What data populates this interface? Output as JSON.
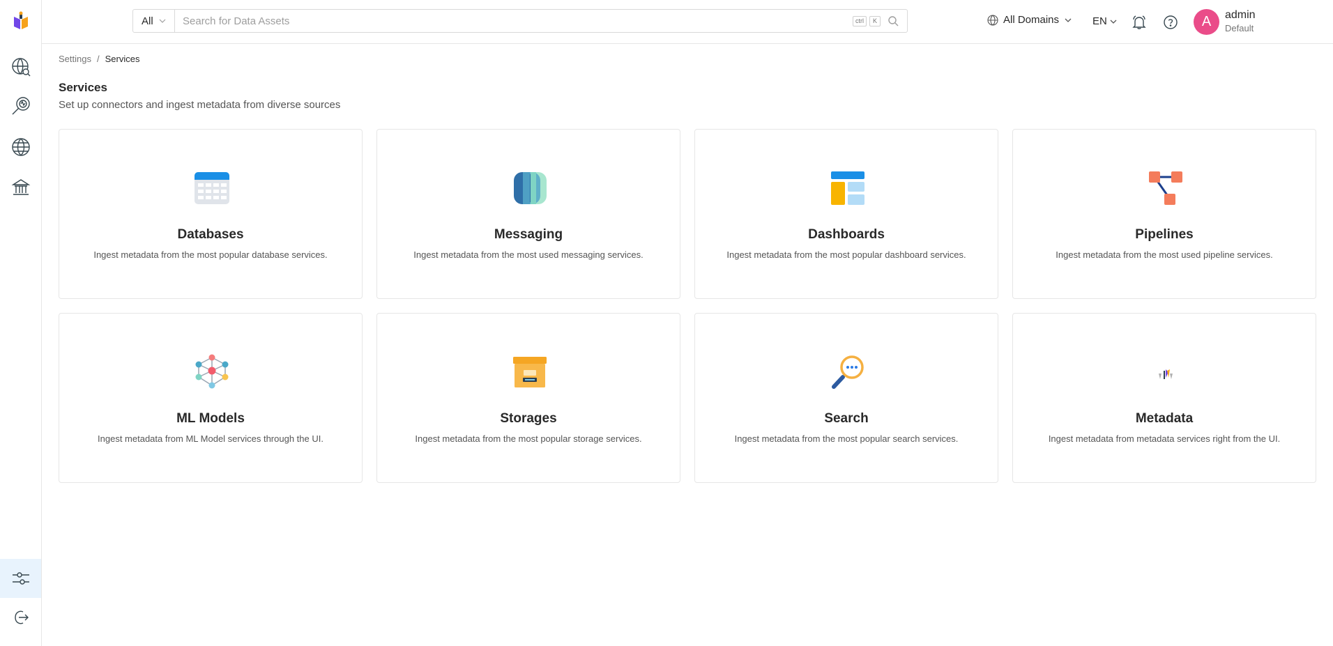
{
  "header": {
    "search_scope": "All",
    "search_placeholder": "Search for Data Assets",
    "shortcut_keys": [
      "ctrl",
      "K"
    ],
    "domains_label": "All Domains",
    "language": "EN",
    "user": {
      "avatar_letter": "A",
      "name": "admin",
      "role": "Default",
      "avatar_color": "#ea4c89"
    }
  },
  "sidebar": {
    "items": [
      {
        "icon": "explore-icon"
      },
      {
        "icon": "observability-icon"
      },
      {
        "icon": "domains-icon"
      },
      {
        "icon": "governance-icon"
      },
      {
        "icon": "settings-icon",
        "active": true
      },
      {
        "icon": "logout-icon"
      }
    ],
    "accent_color": "#0950c5"
  },
  "breadcrumb": {
    "items": [
      "Settings",
      "Services"
    ],
    "separator": "/"
  },
  "page": {
    "title": "Services",
    "subtitle": "Set up connectors and ingest metadata from diverse sources"
  },
  "cards": [
    {
      "title": "Databases",
      "description": "Ingest metadata from the most popular database services.",
      "icon": "database-icon"
    },
    {
      "title": "Messaging",
      "description": "Ingest metadata from the most used messaging services.",
      "icon": "messaging-icon"
    },
    {
      "title": "Dashboards",
      "description": "Ingest metadata from the most popular dashboard services.",
      "icon": "dashboard-icon"
    },
    {
      "title": "Pipelines",
      "description": "Ingest metadata from the most used pipeline services.",
      "icon": "pipeline-icon"
    },
    {
      "title": "ML Models",
      "description": "Ingest metadata from ML Model services through the UI.",
      "icon": "ml-model-icon"
    },
    {
      "title": "Storages",
      "description": "Ingest metadata from the most popular storage services.",
      "icon": "storage-icon"
    },
    {
      "title": "Search",
      "description": "Ingest metadata from the most popular search services.",
      "icon": "search-service-icon"
    },
    {
      "title": "Metadata",
      "description": "Ingest metadata from metadata services right from the UI.",
      "icon": "metadata-icon"
    }
  ]
}
